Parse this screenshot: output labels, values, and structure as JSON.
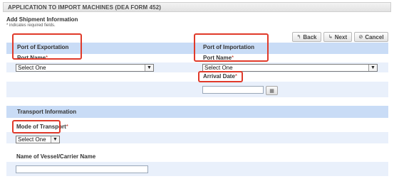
{
  "header": {
    "title": "APPLICATION TO IMPORT MACHINES (DEA FORM 452)"
  },
  "form": {
    "heading": "Add Shipment Information",
    "required_note": "* indicates required fields.",
    "required_marker": "*"
  },
  "toolbar": {
    "back_label": "Back",
    "next_label": "Next",
    "cancel_label": "Cancel",
    "back_icon": "back-arrow-icon",
    "next_icon": "forward-arrow-icon",
    "cancel_icon": "cancel-circle-icon"
  },
  "export": {
    "section_label": "Port of Exportation",
    "port_label": "Port Name",
    "port_value": "Select One"
  },
  "import": {
    "section_label": "Port of Importation",
    "port_label": "Port Name",
    "port_value": "Select One",
    "arrival_label": "Arrival Date",
    "arrival_value": ""
  },
  "transport": {
    "section_label": "Transport Information",
    "mode_label": "Mode of Transport",
    "mode_value": "Select One",
    "vessel_label": "Name of Vessel/Carrier Name",
    "vessel_value": ""
  },
  "colors": {
    "band": "#c9dcf6",
    "band_light": "#e9f0fb",
    "highlight": "#e03a2a",
    "required": "#c0392b"
  }
}
